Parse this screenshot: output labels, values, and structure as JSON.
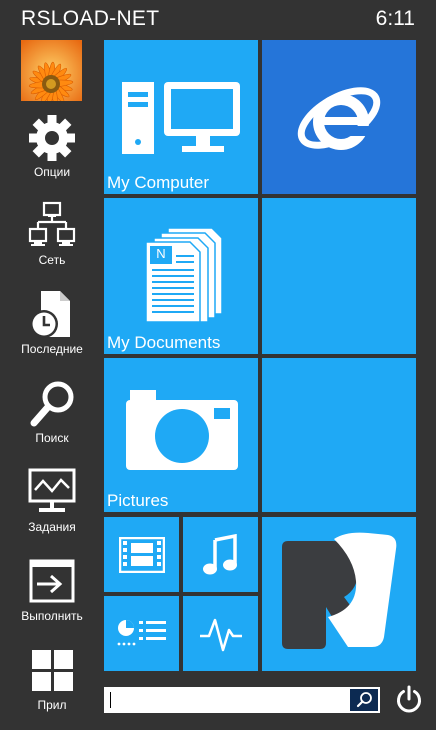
{
  "header": {
    "title": "RSLOAD-NET",
    "time": "6:11"
  },
  "sidebar": {
    "items": [
      {
        "label": "Опции",
        "icon": "gear-icon"
      },
      {
        "label": "Сеть",
        "icon": "network-icon"
      },
      {
        "label": "Последние",
        "icon": "recent-icon"
      },
      {
        "label": "Поиск",
        "icon": "search-icon"
      },
      {
        "label": "Задания",
        "icon": "task-monitor-icon"
      },
      {
        "label": "Выполнить",
        "icon": "run-icon"
      },
      {
        "label": "Прил",
        "icon": "apps-grid-icon"
      }
    ]
  },
  "tiles": {
    "computer": {
      "label": "My Computer"
    },
    "documents": {
      "label": "My Documents",
      "doc_letter": "N"
    },
    "pictures": {
      "label": "Pictures"
    }
  },
  "search": {
    "value": "",
    "placeholder": ""
  },
  "colors": {
    "tile": "#1fa9f5",
    "ie_tile": "#2575d9",
    "background": "#333333",
    "search_button": "#0c2a52"
  }
}
